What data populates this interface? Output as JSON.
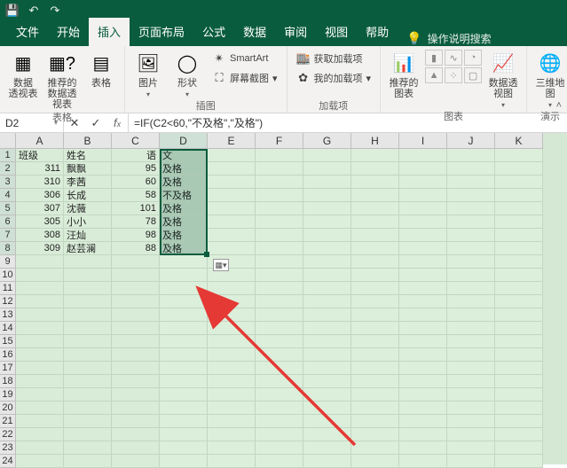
{
  "qat": {
    "save_icon": "💾",
    "undo_icon": "↶",
    "redo_icon": "↷"
  },
  "tabs": {
    "file": "文件",
    "home": "开始",
    "insert": "插入",
    "layout": "页面布局",
    "formulas": "公式",
    "data": "数据",
    "review": "审阅",
    "view": "视图",
    "help": "帮助",
    "tellme": "操作说明搜索"
  },
  "ribbon": {
    "tables": {
      "group": "表格",
      "pivot": "数据\n透视表",
      "recommended_pivot": "推荐的\n数据透视表",
      "table": "表格"
    },
    "illustrations": {
      "group": "插图",
      "pictures": "图片",
      "shapes": "形状",
      "smartart": "SmartArt",
      "screenshot": "屏幕截图"
    },
    "addins": {
      "group": "加载项",
      "get": "获取加载项",
      "my": "我的加载项"
    },
    "charts": {
      "group": "图表",
      "recommended": "推荐的\n图表",
      "pivotchart": "数据透视图"
    },
    "tours": {
      "group": "演示",
      "map3d": "三维地\n图"
    },
    "sparklines": {
      "line": "折线"
    }
  },
  "fbar": {
    "name": "D2",
    "formula": "=IF(C2<60,\"不及格\",\"及格\")"
  },
  "columns": [
    "A",
    "B",
    "C",
    "D",
    "E",
    "F",
    "G",
    "H",
    "I",
    "J",
    "K"
  ],
  "rows": [
    "1",
    "2",
    "3",
    "4",
    "5",
    "6",
    "7",
    "8",
    "9",
    "10",
    "11",
    "12",
    "13",
    "14",
    "15",
    "16",
    "17",
    "18",
    "19",
    "20",
    "21",
    "22",
    "23",
    "24"
  ],
  "data": {
    "header": {
      "class": "班级",
      "name": "姓名",
      "chinese": "语文"
    },
    "records": [
      {
        "class": 311,
        "name": "飘飘",
        "score": 95,
        "result": "及格"
      },
      {
        "class": 310,
        "name": "李茜",
        "score": 60,
        "result": "及格"
      },
      {
        "class": 306,
        "name": "长成",
        "score": 58,
        "result": "不及格"
      },
      {
        "class": 307,
        "name": "沈薇",
        "score": 101,
        "result": "及格"
      },
      {
        "class": 305,
        "name": "小小",
        "score": 78,
        "result": "及格"
      },
      {
        "class": 308,
        "name": "汪灿",
        "score": 98,
        "result": "及格"
      },
      {
        "class": 309,
        "name": "赵芸澜",
        "score": 88,
        "result": "及格"
      }
    ]
  }
}
